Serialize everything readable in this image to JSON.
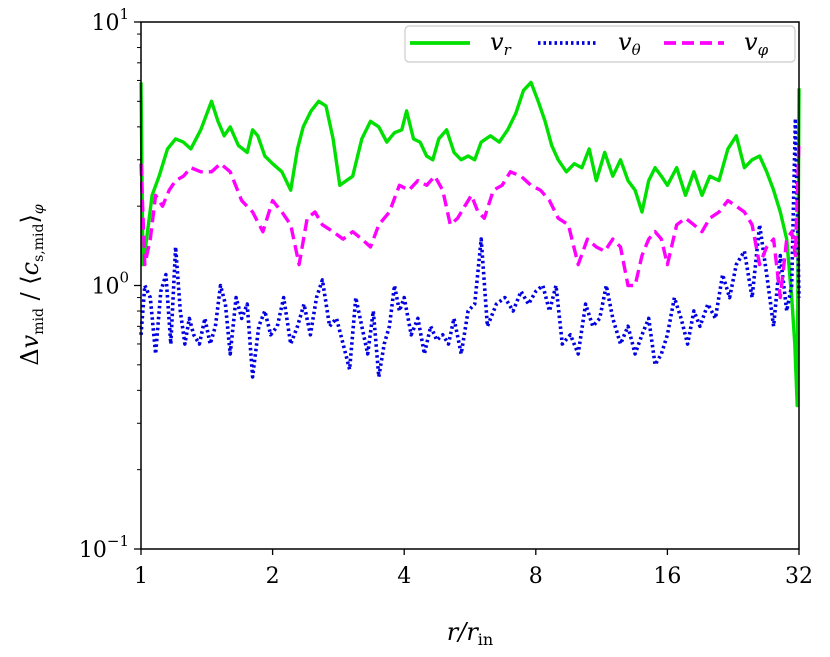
{
  "chart_data": {
    "type": "line",
    "title": "",
    "xlabel": "r/r_in",
    "ylabel": "Δv_mid / ⟨c_s,mid⟩_φ",
    "xscale": "log2",
    "yscale": "log10",
    "xlim": [
      1,
      32
    ],
    "ylim": [
      0.1,
      10
    ],
    "x_ticks": [
      {
        "value": 1,
        "label": "1"
      },
      {
        "value": 2,
        "label": "2"
      },
      {
        "value": 4,
        "label": "4"
      },
      {
        "value": 8,
        "label": "8"
      },
      {
        "value": 16,
        "label": "16"
      },
      {
        "value": 32,
        "label": "32"
      }
    ],
    "y_ticks": [
      {
        "value": 0.1,
        "base": "10",
        "exp": "−1"
      },
      {
        "value": 1,
        "base": "10",
        "exp": "0"
      },
      {
        "value": 10,
        "base": "10",
        "exp": "1"
      }
    ],
    "legend": {
      "placement": "top-right",
      "frame": true
    },
    "series": [
      {
        "name": "v_r",
        "label_main": "v",
        "label_sub": "r",
        "color": "#00e000",
        "style": "solid",
        "x": [
          1.0,
          1.01,
          1.03,
          1.06,
          1.1,
          1.15,
          1.2,
          1.25,
          1.3,
          1.37,
          1.45,
          1.5,
          1.55,
          1.6,
          1.67,
          1.75,
          1.8,
          1.85,
          1.92,
          2.0,
          2.1,
          2.2,
          2.28,
          2.35,
          2.45,
          2.55,
          2.65,
          2.75,
          2.85,
          2.95,
          3.05,
          3.2,
          3.35,
          3.5,
          3.65,
          3.8,
          3.95,
          4.05,
          4.2,
          4.35,
          4.5,
          4.65,
          4.8,
          5.0,
          5.2,
          5.4,
          5.6,
          5.8,
          6.0,
          6.3,
          6.6,
          6.9,
          7.2,
          7.5,
          7.8,
          8.1,
          8.4,
          8.7,
          9.0,
          9.4,
          9.8,
          10.2,
          10.6,
          11.0,
          11.5,
          12.0,
          12.5,
          13.0,
          13.5,
          14.0,
          14.5,
          15.0,
          15.5,
          16.0,
          16.8,
          17.6,
          18.4,
          19.2,
          20.0,
          21.0,
          22.0,
          23.0,
          24.0,
          25.0,
          26.0,
          27.0,
          28.0,
          29.0,
          30.0,
          30.8,
          31.3,
          31.7,
          32.0
        ],
        "y": [
          5.9,
          1.2,
          1.5,
          2.2,
          2.6,
          3.3,
          3.6,
          3.5,
          3.3,
          3.9,
          5.0,
          4.2,
          3.7,
          4.0,
          3.4,
          3.2,
          3.9,
          3.7,
          3.1,
          2.9,
          2.7,
          2.3,
          3.3,
          4.0,
          4.6,
          5.0,
          4.8,
          3.6,
          2.4,
          2.5,
          2.6,
          3.6,
          4.2,
          4.0,
          3.5,
          3.8,
          3.9,
          4.6,
          3.6,
          3.5,
          3.1,
          3.0,
          3.6,
          3.9,
          3.2,
          3.0,
          3.1,
          3.0,
          3.5,
          3.7,
          3.5,
          3.9,
          4.5,
          5.5,
          5.9,
          5.0,
          4.2,
          3.4,
          3.0,
          2.7,
          2.9,
          2.8,
          3.3,
          2.5,
          3.2,
          2.6,
          3.0,
          2.5,
          2.3,
          1.9,
          2.5,
          2.8,
          2.6,
          2.4,
          2.8,
          2.2,
          2.7,
          2.2,
          2.6,
          2.5,
          3.3,
          3.7,
          2.8,
          3.0,
          3.1,
          2.7,
          2.3,
          1.9,
          1.5,
          0.9,
          0.6,
          0.35,
          5.6
        ]
      },
      {
        "name": "v_θ",
        "label_main": "v",
        "label_sub": "θ",
        "color": "#0000e0",
        "style": "dotted",
        "x": [
          1.0,
          1.02,
          1.05,
          1.08,
          1.11,
          1.14,
          1.17,
          1.2,
          1.23,
          1.26,
          1.29,
          1.32,
          1.36,
          1.4,
          1.44,
          1.48,
          1.52,
          1.56,
          1.6,
          1.65,
          1.7,
          1.75,
          1.8,
          1.86,
          1.92,
          1.98,
          2.05,
          2.12,
          2.2,
          2.28,
          2.36,
          2.44,
          2.52,
          2.6,
          2.7,
          2.8,
          2.9,
          3.0,
          3.1,
          3.2,
          3.3,
          3.4,
          3.5,
          3.6,
          3.7,
          3.8,
          3.9,
          4.0,
          4.15,
          4.3,
          4.45,
          4.6,
          4.75,
          4.9,
          5.05,
          5.2,
          5.4,
          5.6,
          5.8,
          6.0,
          6.2,
          6.5,
          6.8,
          7.1,
          7.4,
          7.7,
          8.0,
          8.3,
          8.6,
          8.9,
          9.2,
          9.6,
          10.0,
          10.4,
          10.8,
          11.2,
          11.6,
          12.0,
          12.5,
          13.0,
          13.5,
          14.0,
          14.5,
          15.0,
          15.5,
          16.0,
          16.6,
          17.2,
          17.8,
          18.4,
          19.0,
          19.8,
          20.6,
          21.4,
          22.2,
          23.0,
          24.0,
          25.0,
          26.0,
          27.0,
          28.0,
          29.0,
          30.0,
          30.8,
          31.4,
          32.0
        ],
        "y": [
          0.65,
          1.0,
          0.9,
          0.55,
          0.95,
          1.1,
          0.6,
          1.4,
          0.8,
          0.6,
          0.75,
          0.65,
          0.6,
          0.75,
          0.6,
          0.7,
          1.0,
          0.85,
          0.55,
          0.9,
          0.75,
          0.85,
          0.45,
          0.7,
          0.8,
          0.65,
          0.7,
          0.9,
          0.6,
          0.7,
          0.85,
          0.65,
          0.9,
          1.05,
          0.7,
          0.75,
          0.6,
          0.48,
          0.9,
          0.7,
          0.55,
          0.8,
          0.45,
          0.6,
          0.7,
          1.0,
          0.8,
          0.9,
          0.65,
          0.75,
          0.55,
          0.7,
          0.62,
          0.65,
          0.6,
          0.75,
          0.55,
          0.8,
          0.85,
          1.5,
          0.7,
          0.85,
          0.9,
          0.8,
          0.95,
          0.85,
          0.95,
          1.0,
          0.8,
          1.0,
          0.6,
          0.65,
          0.55,
          0.85,
          0.7,
          0.75,
          1.0,
          0.75,
          0.6,
          0.7,
          0.55,
          0.65,
          0.75,
          0.5,
          0.55,
          0.65,
          0.9,
          0.75,
          0.6,
          0.8,
          0.7,
          0.85,
          0.75,
          1.1,
          0.9,
          1.2,
          1.35,
          0.9,
          1.7,
          1.1,
          0.7,
          1.3,
          0.8,
          1.0,
          4.3,
          0.9
        ]
      },
      {
        "name": "v_φ",
        "label_main": "v",
        "label_sub": "φ",
        "color": "#ff00ff",
        "style": "dashed",
        "x": [
          1.0,
          1.02,
          1.05,
          1.08,
          1.12,
          1.16,
          1.2,
          1.25,
          1.3,
          1.37,
          1.45,
          1.52,
          1.6,
          1.7,
          1.8,
          1.9,
          2.0,
          2.1,
          2.2,
          2.3,
          2.4,
          2.5,
          2.6,
          2.75,
          2.9,
          3.05,
          3.2,
          3.35,
          3.5,
          3.7,
          3.9,
          4.1,
          4.3,
          4.5,
          4.7,
          4.9,
          5.1,
          5.3,
          5.5,
          5.7,
          5.9,
          6.1,
          6.4,
          6.7,
          7.0,
          7.4,
          7.8,
          8.2,
          8.6,
          9.0,
          9.5,
          10.0,
          10.5,
          11.0,
          11.5,
          12.0,
          12.5,
          13.0,
          13.5,
          14.0,
          14.5,
          15.0,
          15.5,
          16.0,
          16.8,
          17.6,
          18.4,
          19.2,
          20.0,
          21.0,
          22.0,
          23.0,
          24.0,
          25.0,
          26.0,
          27.0,
          28.0,
          29.0,
          30.0,
          30.8,
          31.4,
          32.0
        ],
        "y": [
          2.9,
          1.2,
          1.5,
          2.2,
          2.0,
          2.3,
          2.5,
          2.6,
          2.8,
          2.7,
          2.7,
          2.9,
          2.7,
          2.1,
          1.9,
          1.6,
          2.1,
          1.9,
          1.7,
          1.2,
          1.8,
          1.9,
          1.7,
          1.6,
          1.5,
          1.6,
          1.5,
          1.4,
          1.7,
          1.9,
          2.4,
          2.3,
          2.5,
          2.4,
          2.6,
          2.3,
          1.7,
          1.8,
          2.0,
          2.2,
          1.9,
          1.8,
          2.3,
          2.4,
          2.7,
          2.6,
          2.4,
          2.3,
          2.1,
          1.8,
          1.7,
          1.2,
          1.5,
          1.4,
          1.35,
          1.5,
          1.4,
          1.0,
          1.0,
          1.3,
          1.5,
          1.6,
          1.5,
          1.2,
          1.7,
          1.8,
          1.7,
          1.6,
          1.8,
          1.9,
          2.1,
          2.0,
          1.9,
          1.7,
          1.2,
          1.4,
          1.5,
          0.9,
          1.5,
          1.6,
          1.3,
          3.5
        ]
      }
    ]
  }
}
